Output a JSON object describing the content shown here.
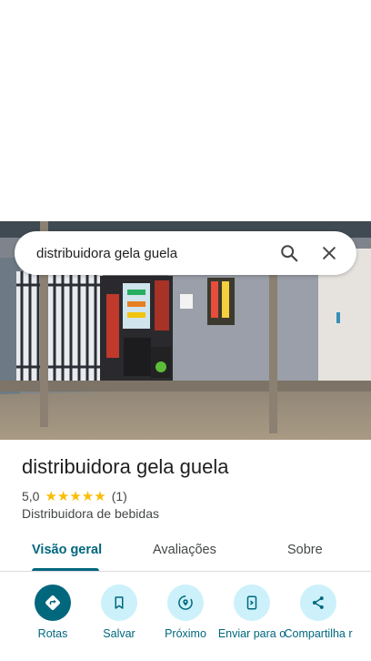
{
  "search": {
    "query": "distribuidora gela guela"
  },
  "place": {
    "name": "distribuidora gela guela",
    "rating": "5,0",
    "stars": "★★★★★",
    "review_count": "(1)",
    "category": "Distribuidora de bebidas"
  },
  "tabs": [
    {
      "label": "Visão geral",
      "active": true
    },
    {
      "label": "Avaliações",
      "active": false
    },
    {
      "label": "Sobre",
      "active": false
    }
  ],
  "actions": [
    {
      "label": "Rotas",
      "icon": "directions-icon"
    },
    {
      "label": "Salvar",
      "icon": "bookmark-icon"
    },
    {
      "label": "Próximo",
      "icon": "nearby-icon"
    },
    {
      "label": "Enviar para o",
      "icon": "send-to-phone-icon"
    },
    {
      "label": "Compartilha r",
      "icon": "share-icon"
    }
  ],
  "colors": {
    "accent": "#00677d",
    "action_bg": "#ccf1fa",
    "star": "#fbbc04"
  }
}
